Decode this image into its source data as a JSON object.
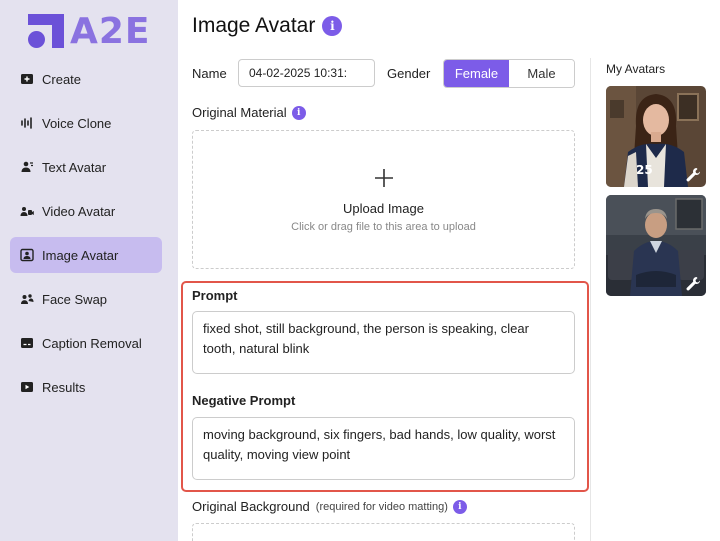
{
  "brand": {
    "name": "A2E",
    "primary": "#7c5ce8",
    "sidebar_bg": "#e4e2ef",
    "active_bg": "#c7bcef",
    "highlight": "#e2564a"
  },
  "sidebar": {
    "items": [
      {
        "label": "Create",
        "icon": "add-box-icon"
      },
      {
        "label": "Voice Clone",
        "icon": "waveform-icon"
      },
      {
        "label": "Text Avatar",
        "icon": "person-text-icon"
      },
      {
        "label": "Video Avatar",
        "icon": "video-person-icon"
      },
      {
        "label": "Image Avatar",
        "icon": "image-person-icon",
        "active": true
      },
      {
        "label": "Face Swap",
        "icon": "face-swap-icon"
      },
      {
        "label": "Caption Removal",
        "icon": "caption-icon"
      },
      {
        "label": "Results",
        "icon": "play-box-icon"
      }
    ]
  },
  "page": {
    "title": "Image Avatar",
    "info": "i"
  },
  "form": {
    "name_label": "Name",
    "name_value": "04-02-2025 10:31:",
    "gender_label": "Gender",
    "gender_options": [
      "Female",
      "Male"
    ],
    "gender_selected": "Female",
    "original_material_label": "Original Material",
    "upload_title": "Upload Image",
    "upload_hint": "Click or drag file to this area to upload",
    "prompt_label": "Prompt",
    "prompt_value": "fixed shot, still background, the person is speaking, clear tooth, natural blink",
    "negative_prompt_label": "Negative Prompt",
    "negative_prompt_value": "moving background, six fingers, bad hands, low quality, worst quality, moving view point",
    "original_background_label": "Original Background",
    "original_background_note": "(required for video matting)"
  },
  "avatars": {
    "title": "My Avatars",
    "items": [
      {
        "desc": "woman-in-varsity-jacket",
        "icon": "wrench-icon"
      },
      {
        "desc": "man-seated-on-sofa",
        "icon": "wrench-icon"
      }
    ]
  }
}
